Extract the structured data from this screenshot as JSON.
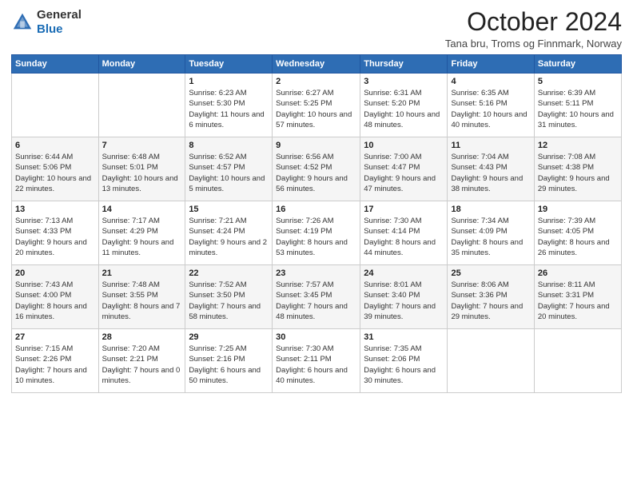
{
  "header": {
    "logo_line1": "General",
    "logo_line2": "Blue",
    "month_title": "October 2024",
    "location": "Tana bru, Troms og Finnmark, Norway"
  },
  "weekdays": [
    "Sunday",
    "Monday",
    "Tuesday",
    "Wednesday",
    "Thursday",
    "Friday",
    "Saturday"
  ],
  "weeks": [
    [
      {
        "day": "",
        "info": ""
      },
      {
        "day": "",
        "info": ""
      },
      {
        "day": "1",
        "info": "Sunrise: 6:23 AM\nSunset: 5:30 PM\nDaylight: 11 hours and 6 minutes."
      },
      {
        "day": "2",
        "info": "Sunrise: 6:27 AM\nSunset: 5:25 PM\nDaylight: 10 hours and 57 minutes."
      },
      {
        "day": "3",
        "info": "Sunrise: 6:31 AM\nSunset: 5:20 PM\nDaylight: 10 hours and 48 minutes."
      },
      {
        "day": "4",
        "info": "Sunrise: 6:35 AM\nSunset: 5:16 PM\nDaylight: 10 hours and 40 minutes."
      },
      {
        "day": "5",
        "info": "Sunrise: 6:39 AM\nSunset: 5:11 PM\nDaylight: 10 hours and 31 minutes."
      }
    ],
    [
      {
        "day": "6",
        "info": "Sunrise: 6:44 AM\nSunset: 5:06 PM\nDaylight: 10 hours and 22 minutes."
      },
      {
        "day": "7",
        "info": "Sunrise: 6:48 AM\nSunset: 5:01 PM\nDaylight: 10 hours and 13 minutes."
      },
      {
        "day": "8",
        "info": "Sunrise: 6:52 AM\nSunset: 4:57 PM\nDaylight: 10 hours and 5 minutes."
      },
      {
        "day": "9",
        "info": "Sunrise: 6:56 AM\nSunset: 4:52 PM\nDaylight: 9 hours and 56 minutes."
      },
      {
        "day": "10",
        "info": "Sunrise: 7:00 AM\nSunset: 4:47 PM\nDaylight: 9 hours and 47 minutes."
      },
      {
        "day": "11",
        "info": "Sunrise: 7:04 AM\nSunset: 4:43 PM\nDaylight: 9 hours and 38 minutes."
      },
      {
        "day": "12",
        "info": "Sunrise: 7:08 AM\nSunset: 4:38 PM\nDaylight: 9 hours and 29 minutes."
      }
    ],
    [
      {
        "day": "13",
        "info": "Sunrise: 7:13 AM\nSunset: 4:33 PM\nDaylight: 9 hours and 20 minutes."
      },
      {
        "day": "14",
        "info": "Sunrise: 7:17 AM\nSunset: 4:29 PM\nDaylight: 9 hours and 11 minutes."
      },
      {
        "day": "15",
        "info": "Sunrise: 7:21 AM\nSunset: 4:24 PM\nDaylight: 9 hours and 2 minutes."
      },
      {
        "day": "16",
        "info": "Sunrise: 7:26 AM\nSunset: 4:19 PM\nDaylight: 8 hours and 53 minutes."
      },
      {
        "day": "17",
        "info": "Sunrise: 7:30 AM\nSunset: 4:14 PM\nDaylight: 8 hours and 44 minutes."
      },
      {
        "day": "18",
        "info": "Sunrise: 7:34 AM\nSunset: 4:09 PM\nDaylight: 8 hours and 35 minutes."
      },
      {
        "day": "19",
        "info": "Sunrise: 7:39 AM\nSunset: 4:05 PM\nDaylight: 8 hours and 26 minutes."
      }
    ],
    [
      {
        "day": "20",
        "info": "Sunrise: 7:43 AM\nSunset: 4:00 PM\nDaylight: 8 hours and 16 minutes."
      },
      {
        "day": "21",
        "info": "Sunrise: 7:48 AM\nSunset: 3:55 PM\nDaylight: 8 hours and 7 minutes."
      },
      {
        "day": "22",
        "info": "Sunrise: 7:52 AM\nSunset: 3:50 PM\nDaylight: 7 hours and 58 minutes."
      },
      {
        "day": "23",
        "info": "Sunrise: 7:57 AM\nSunset: 3:45 PM\nDaylight: 7 hours and 48 minutes."
      },
      {
        "day": "24",
        "info": "Sunrise: 8:01 AM\nSunset: 3:40 PM\nDaylight: 7 hours and 39 minutes."
      },
      {
        "day": "25",
        "info": "Sunrise: 8:06 AM\nSunset: 3:36 PM\nDaylight: 7 hours and 29 minutes."
      },
      {
        "day": "26",
        "info": "Sunrise: 8:11 AM\nSunset: 3:31 PM\nDaylight: 7 hours and 20 minutes."
      }
    ],
    [
      {
        "day": "27",
        "info": "Sunrise: 7:15 AM\nSunset: 2:26 PM\nDaylight: 7 hours and 10 minutes."
      },
      {
        "day": "28",
        "info": "Sunrise: 7:20 AM\nSunset: 2:21 PM\nDaylight: 7 hours and 0 minutes."
      },
      {
        "day": "29",
        "info": "Sunrise: 7:25 AM\nSunset: 2:16 PM\nDaylight: 6 hours and 50 minutes."
      },
      {
        "day": "30",
        "info": "Sunrise: 7:30 AM\nSunset: 2:11 PM\nDaylight: 6 hours and 40 minutes."
      },
      {
        "day": "31",
        "info": "Sunrise: 7:35 AM\nSunset: 2:06 PM\nDaylight: 6 hours and 30 minutes."
      },
      {
        "day": "",
        "info": ""
      },
      {
        "day": "",
        "info": ""
      }
    ]
  ]
}
